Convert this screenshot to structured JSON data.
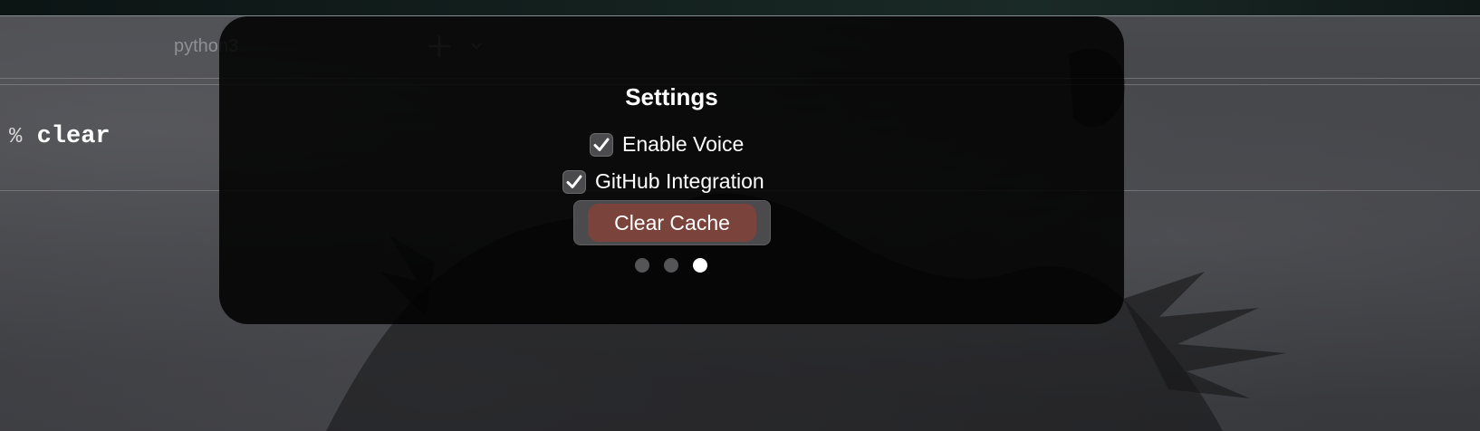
{
  "terminal": {
    "tab_title": "python3",
    "prompt_symbol": "%",
    "command": "clear",
    "icons": {
      "new_tab": "plus-icon",
      "tab_menu": "chevron-down-icon"
    }
  },
  "settings": {
    "title": "Settings",
    "options": [
      {
        "label": "Enable Voice",
        "checked": true
      },
      {
        "label": "GitHub Integration",
        "checked": true
      }
    ],
    "clear_cache_label": "Clear Cache",
    "pager": {
      "count": 3,
      "active_index": 3
    }
  },
  "colors": {
    "panel_background": "#000000",
    "clear_button": "#7a433b",
    "checkbox": "#4b4b4d",
    "active_dot": "#ffffff",
    "inactive_dot": "#555557"
  }
}
